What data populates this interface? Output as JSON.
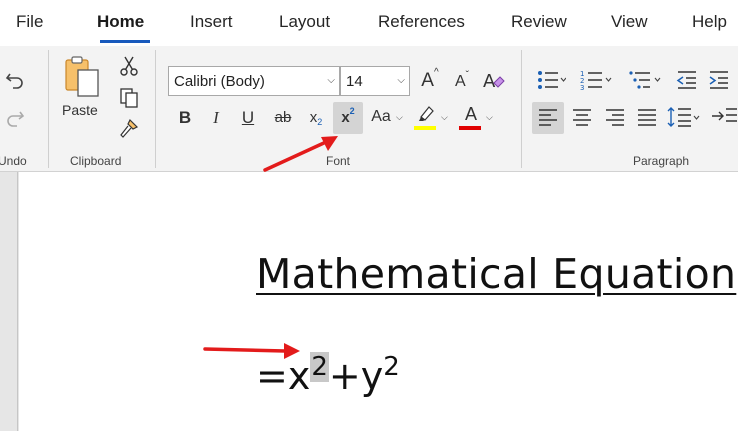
{
  "menu": {
    "tabs": [
      "File",
      "Home",
      "Insert",
      "Layout",
      "References",
      "Review",
      "View",
      "Help"
    ],
    "active": "Home"
  },
  "ribbon": {
    "undo_group_label": "Undo",
    "clipboard": {
      "paste_label": "Paste",
      "group_label": "Clipboard"
    },
    "font": {
      "font_name": "Calibri (Body)",
      "font_size": "14",
      "bold": "B",
      "italic": "I",
      "underline": "U",
      "strikethrough": "ab",
      "subscript": "x",
      "subscript_mark": "2",
      "superscript": "x",
      "superscript_mark": "2",
      "change_case": "Aa",
      "font_color_letter": "A",
      "group_label": "Font",
      "highlight_color": "#ffff00",
      "font_color": "#e00000"
    },
    "paragraph": {
      "group_label": "Paragraph"
    }
  },
  "document": {
    "heading": "Mathematical Equation",
    "equation": {
      "prefix": "=x",
      "exp1": "2",
      "middle": "+y",
      "exp2": "2"
    }
  },
  "annotations": {
    "arrow_color": "#e31b1b"
  }
}
